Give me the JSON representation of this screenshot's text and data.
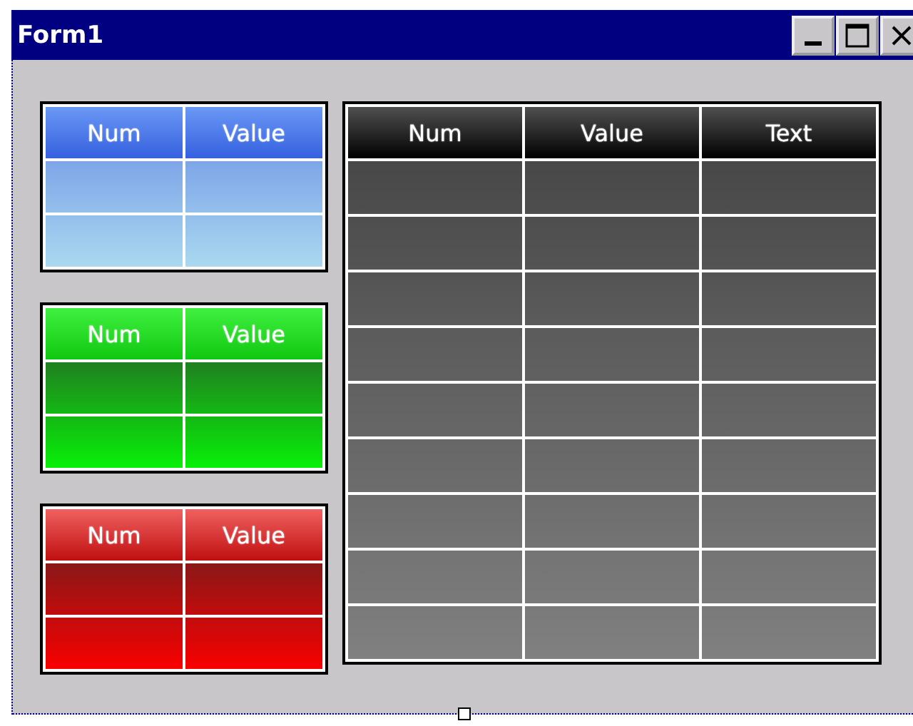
{
  "window": {
    "title": "Form1"
  },
  "tables": [
    {
      "kind": "blue",
      "columns": [
        "Num",
        "Value"
      ],
      "rows": [
        [
          null,
          null
        ],
        [
          null,
          null
        ]
      ]
    },
    {
      "kind": "green",
      "columns": [
        "Num",
        "Value"
      ],
      "rows": [
        [
          null,
          null
        ],
        [
          null,
          null
        ]
      ]
    },
    {
      "kind": "red",
      "columns": [
        "Num",
        "Value"
      ],
      "rows": [
        [
          null,
          null
        ],
        [
          null,
          null
        ]
      ]
    },
    {
      "kind": "black",
      "columns": [
        "Num",
        "Value",
        "Text"
      ],
      "rows": [
        [
          null,
          null,
          null
        ],
        [
          null,
          null,
          null
        ],
        [
          null,
          null,
          null
        ],
        [
          null,
          null,
          null
        ],
        [
          null,
          null,
          null
        ],
        [
          null,
          null,
          null
        ],
        [
          null,
          null,
          null
        ],
        [
          null,
          null,
          null
        ],
        [
          null,
          null,
          null
        ]
      ]
    }
  ]
}
